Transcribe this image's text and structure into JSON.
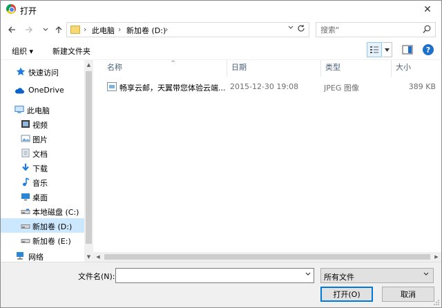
{
  "window": {
    "title": "打开",
    "close_glyph": "✕"
  },
  "address": {
    "breadcrumb": [
      "此电脑",
      "新加卷 (D:)"
    ],
    "separator": "›"
  },
  "search": {
    "placeholder": "搜索\""
  },
  "toolbar": {
    "organize_label": "组织 ▾",
    "new_folder_label": "新建文件夹",
    "help_label": "?"
  },
  "nav": {
    "items": [
      {
        "label": "快速访问",
        "icon": "star-icon"
      },
      {
        "label": "OneDrive",
        "icon": "cloud-icon"
      },
      {
        "label": "此电脑",
        "icon": "computer-icon"
      },
      {
        "label": "视频",
        "icon": "video-icon"
      },
      {
        "label": "图片",
        "icon": "pictures-icon"
      },
      {
        "label": "文档",
        "icon": "documents-icon"
      },
      {
        "label": "下载",
        "icon": "download-icon"
      },
      {
        "label": "音乐",
        "icon": "music-icon"
      },
      {
        "label": "桌面",
        "icon": "desktop-icon"
      },
      {
        "label": "本地磁盘 (C:)",
        "icon": "drive-icon"
      },
      {
        "label": "新加卷 (D:)",
        "icon": "drive-icon"
      },
      {
        "label": "新加卷 (E:)",
        "icon": "drive-icon"
      },
      {
        "label": "网络",
        "icon": "network-icon"
      }
    ]
  },
  "columns": {
    "name": "名称",
    "date": "日期",
    "type": "类型",
    "size": "大小"
  },
  "files": [
    {
      "name": "畅享云邮，天翼带您体验云端...",
      "date": "2015-12-30 19:08",
      "type": "JPEG 图像",
      "size": "389 KB"
    }
  ],
  "bottom": {
    "filename_label": "文件名(N):",
    "filename_value": "",
    "filetype_value": "所有文件",
    "open_label": "打开(O)",
    "cancel_label": "取消"
  },
  "colors": {
    "accent": "#0078d7",
    "selection": "#cce8ff",
    "header_text": "#4c607a"
  }
}
